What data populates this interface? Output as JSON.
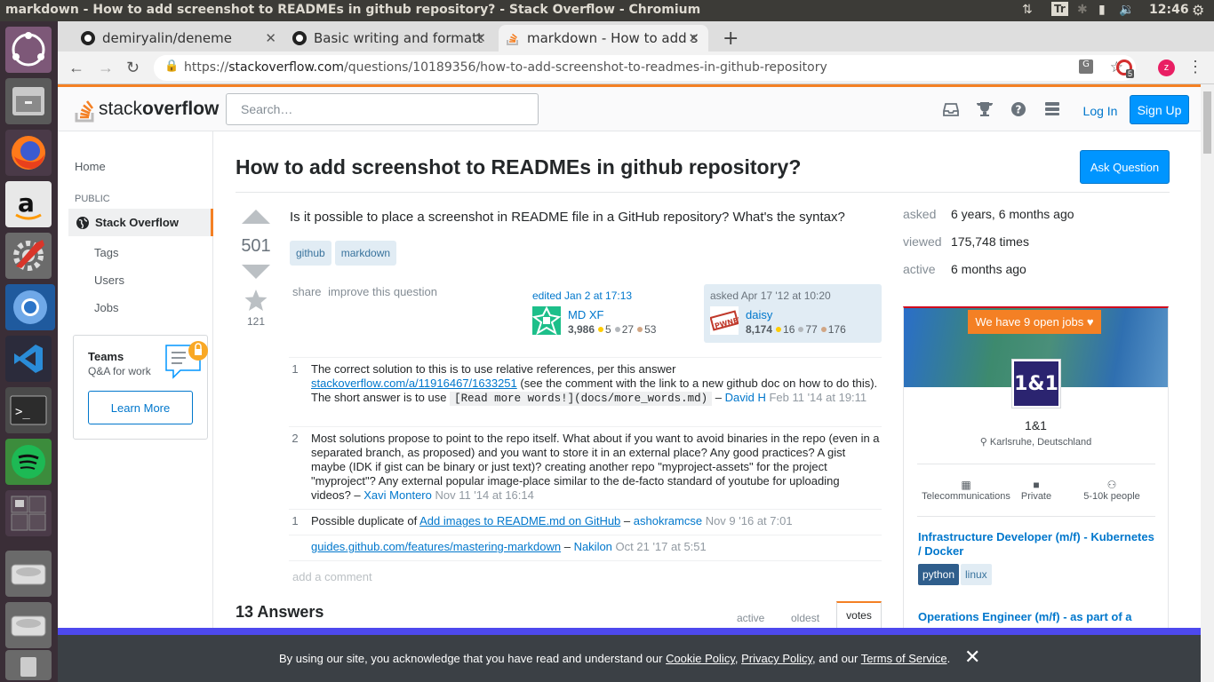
{
  "os": {
    "window_title": "markdown - How to add screenshot to READMEs in github repository? - Stack Overflow - Chromium",
    "clock": "12:46",
    "keyboard_indicator": "Tr"
  },
  "browser": {
    "tabs": [
      {
        "label": "demiryalin/deneme"
      },
      {
        "label": "Basic writing and formatt"
      },
      {
        "label": "markdown - How to add s"
      }
    ],
    "new_tab": "+",
    "url_scheme": "https://",
    "url_host": "stackoverflow.com",
    "url_path": "/questions/10189356/how-to-add-screenshot-to-readmes-in-github-repository",
    "profile_initial": "z",
    "ext_badge": "5"
  },
  "header": {
    "logo_light": "stack",
    "logo_bold": "overflow",
    "search_placeholder": "Search…",
    "login": "Log In",
    "signup": "Sign Up"
  },
  "leftnav": {
    "home": "Home",
    "public": "PUBLIC",
    "stack_overflow": "Stack Overflow",
    "tags": "Tags",
    "users": "Users",
    "jobs": "Jobs",
    "teams_title": "Teams",
    "teams_sub": "Q&A for work",
    "learn_more": "Learn More"
  },
  "question": {
    "title": "How to add screenshot to READMEs in github repository?",
    "ask_button": "Ask Question",
    "votes": "501",
    "favorites": "121",
    "body": "Is it possible to place a screenshot in README file in a GitHub repository? What's the syntax?",
    "tags": [
      "github",
      "markdown"
    ],
    "share": "share",
    "improve": "improve this question",
    "editor": {
      "action": "edited Jan 2 at 17:13",
      "name": "MD XF",
      "rep": "3,986",
      "gold": "5",
      "silver": "27",
      "bronze": "53"
    },
    "asker": {
      "action": "asked Apr 17 '12 at 10:20",
      "name": "daisy",
      "rep": "8,174",
      "gold": "16",
      "silver": "77",
      "bronze": "176"
    },
    "comments": [
      {
        "score": "1",
        "text1": "The correct solution to this is to use relative references, per this answer ",
        "link": "stackoverflow.com/a/11916467/1633251",
        "text2": " (see the comment with the link to a new github doc on how to do this). The short answer is to use ",
        "code": "[Read more words!](docs/more_words.md)",
        "text3": " – ",
        "user": "David H",
        "date": " Feb 11 '14 at 19:11"
      },
      {
        "score": "2",
        "text1": "Most solutions propose to point to the repo itself. What about if you want to avoid binaries in the repo (even in a separated branch, as proposed) and you want to store it in an external place? Any good practices? A gist maybe (IDK if gist can be binary or just text)? creating another repo \"myproject-assets\" for the project \"myproject\"? Any external popular image-place similar to the de-facto standard of youtube for uploading videos? – ",
        "user": "Xavi Montero",
        "date": " Nov 11 '14 at 16:14"
      },
      {
        "score": "1",
        "text1": "Possible duplicate of ",
        "link": "Add images to README.md on GitHub",
        "text3": " – ",
        "user": "ashokramcse",
        "date": " Nov 9 '16 at 7:01"
      },
      {
        "score": "",
        "link": "guides.github.com/features/mastering-markdown",
        "text3": " – ",
        "user": "Nakilon",
        "date": " Oct 21 '17 at 5:51"
      }
    ],
    "add_comment": "add a comment"
  },
  "answers": {
    "count_label": "13 Answers",
    "sort_active": "active",
    "sort_oldest": "oldest",
    "sort_votes": "votes"
  },
  "sidebar": {
    "asked_k": "asked",
    "asked_v": "6 years, 6 months ago",
    "viewed_k": "viewed",
    "viewed_v": "175,748 times",
    "active_k": "active",
    "active_v": "6 months ago",
    "jobs_button": "We have 9 open jobs ♥",
    "company_logo": "1&1",
    "company": "1&1",
    "location": "Karlsruhe, Deutschland",
    "facts": [
      "Telecommunications",
      "Private",
      "5-10k people"
    ],
    "job1": "Infrastructure Developer (m/f) - Kubernetes / Docker",
    "job1_tags": [
      "python",
      "linux"
    ],
    "job2": "Operations Engineer (m/f) - as part of a"
  },
  "cookie": {
    "t1": "By using our site, you acknowledge that you have read and understand our ",
    "l1": "Cookie Policy",
    "t2": ", ",
    "l2": "Privacy Policy",
    "t3": ", and our ",
    "l3": "Terms of Service",
    "t4": ".",
    "close": "✕"
  }
}
